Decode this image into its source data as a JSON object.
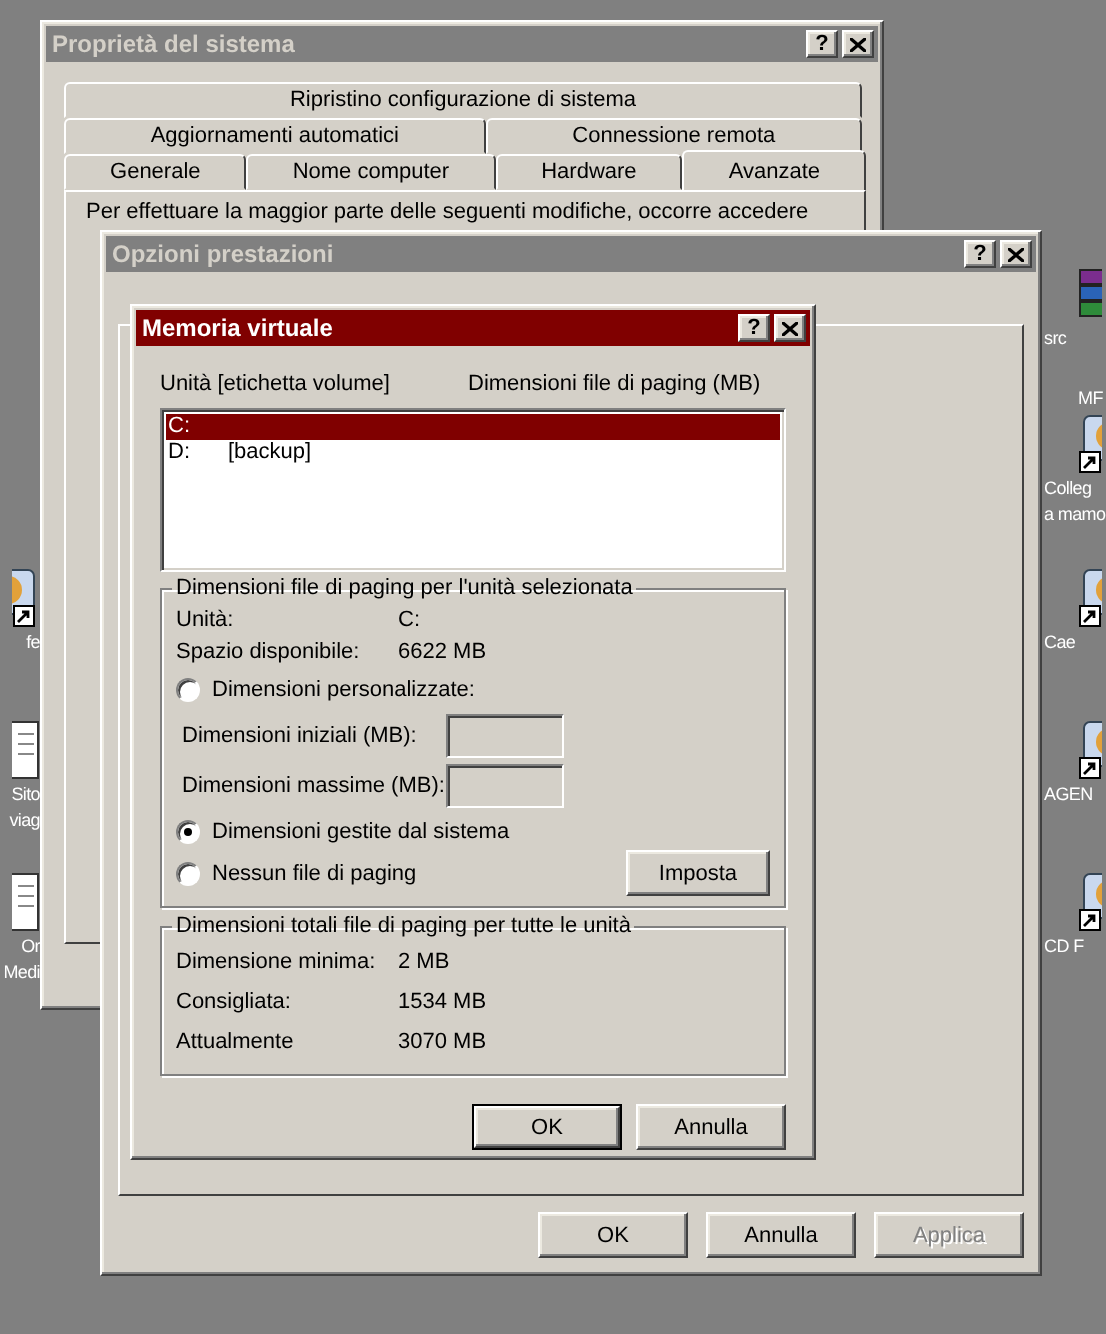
{
  "desktop_icons_left": [
    {
      "kind": "shortcut",
      "lines": [
        "fe"
      ]
    },
    {
      "kind": "document",
      "lines": [
        "Sito",
        "viag"
      ]
    },
    {
      "kind": "document",
      "lines": [
        "Or",
        "Medi"
      ]
    }
  ],
  "desktop_icons_right": [
    {
      "kind": "archive",
      "lines": [
        "src"
      ]
    },
    {
      "kind": "shortcut",
      "badge": "MF",
      "lines": [
        "Colleg",
        "a mamo"
      ]
    },
    {
      "kind": "shortcut",
      "lines": [
        "Cae"
      ]
    },
    {
      "kind": "shortcut",
      "lines": [
        "AGEN"
      ]
    },
    {
      "kind": "shortcut",
      "lines": [
        "CD F"
      ]
    }
  ],
  "system_properties": {
    "title": "Proprietà del sistema",
    "active": false,
    "help": "?",
    "tab_rows": [
      [
        {
          "label": "Ripristino configurazione di sistema",
          "selected": false
        }
      ],
      [
        {
          "label": "Aggiornamenti automatici",
          "selected": false
        },
        {
          "label": "Connessione remota",
          "selected": false
        }
      ],
      [
        {
          "label": "Generale",
          "selected": false
        },
        {
          "label": "Nome computer",
          "selected": false
        },
        {
          "label": "Hardware",
          "selected": false
        },
        {
          "label": "Avanzate",
          "selected": true
        }
      ]
    ],
    "description": "Per effettuare la maggior parte delle seguenti modifiche, occorre accedere"
  },
  "performance_options": {
    "title": "Opzioni prestazioni",
    "active": false,
    "help": "?",
    "buttons": [
      {
        "label": "OK",
        "disabled": false
      },
      {
        "label": "Annulla",
        "disabled": false
      },
      {
        "label": "Applica",
        "disabled": true
      }
    ]
  },
  "virtual_memory": {
    "title": "Memoria virtuale",
    "active": true,
    "help": "?",
    "columns": [
      "Unità [etichetta volume]",
      "Dimensioni file di paging (MB)"
    ],
    "drives": [
      {
        "letter": "C:",
        "selected": true
      },
      {
        "letter": "D:",
        "label": "[backup]",
        "selected": false
      }
    ],
    "selected_drive": {
      "title": "Dimensioni file di paging per l'unità selezionata",
      "items": [
        {
          "kind": "info",
          "label": "Unità:",
          "value": "C:"
        },
        {
          "kind": "info",
          "label": "Spazio disponibile:",
          "value": "6622 MB"
        },
        {
          "kind": "radio",
          "label": "Dimensioni personalizzate:",
          "selected": false
        },
        {
          "kind": "field",
          "label": "Dimensioni iniziali (MB):",
          "disabled": true
        },
        {
          "kind": "field",
          "label": "Dimensioni massime (MB):",
          "disabled": true
        },
        {
          "kind": "radio",
          "label": "Dimensioni gestite dal sistema",
          "selected": true
        },
        {
          "kind": "radio",
          "label": "Nessun file di paging",
          "selected": false
        }
      ],
      "set_button": "Imposta"
    },
    "totals": {
      "title": "Dimensioni totali file di paging per tutte le unità",
      "rows": [
        {
          "label": "Dimensione minima:",
          "value": "2 MB"
        },
        {
          "label": "Consigliata:",
          "value": "1534 MB"
        },
        {
          "label": "Attualmente",
          "value": "3070 MB"
        }
      ]
    },
    "buttons": [
      {
        "label": "OK",
        "default": true
      },
      {
        "label": "Annulla",
        "default": false
      }
    ]
  }
}
